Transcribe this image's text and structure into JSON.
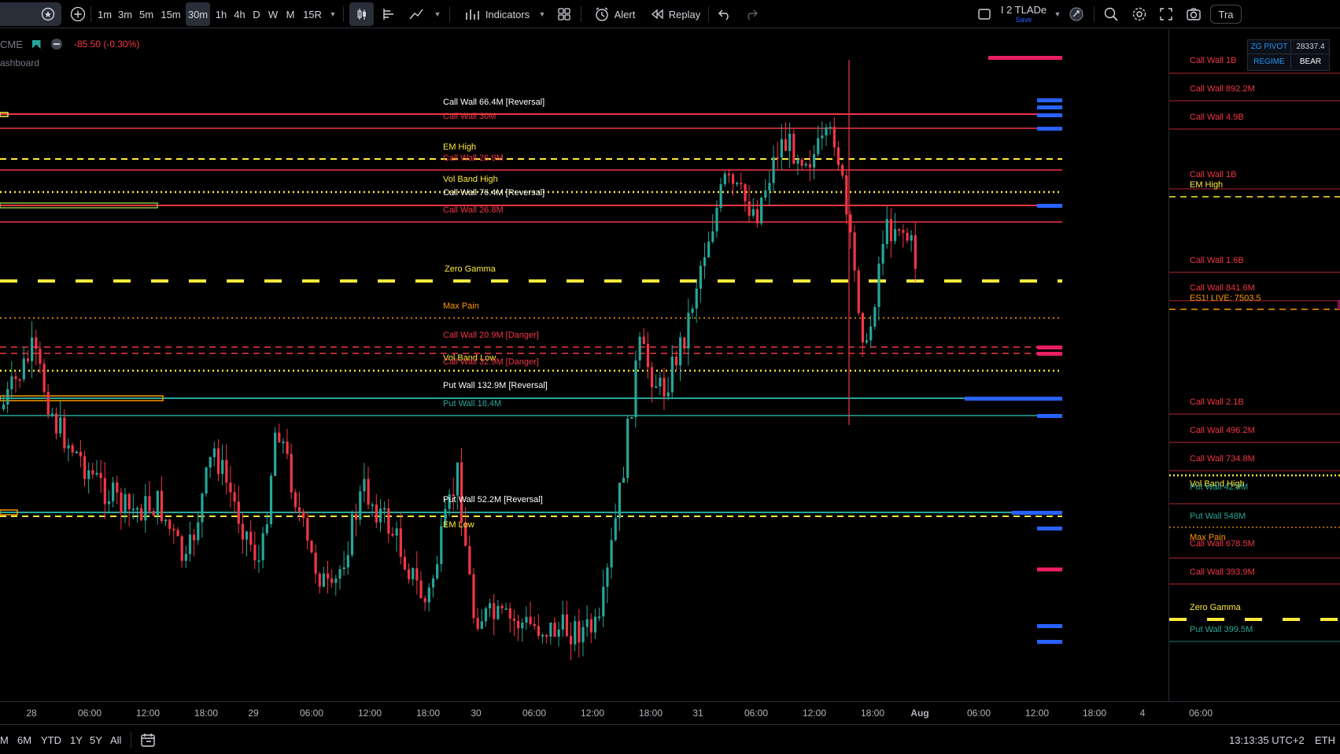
{
  "toolbar": {
    "timeframes": [
      "1m",
      "3m",
      "5m",
      "15m",
      "30m",
      "1h",
      "4h",
      "D",
      "W",
      "M",
      "15R"
    ],
    "active_timeframe": "30m",
    "indicators_label": "Indicators",
    "alert_label": "Alert",
    "replay_label": "Replay",
    "layout_name": "I 2 TLADe",
    "layout_sub": "Save",
    "trade_label": "Tra"
  },
  "legend": {
    "symbol": "CME",
    "change": "-85.50 (-0.30%)",
    "dashboard": "ashboard"
  },
  "zg_widget": {
    "label": "ZG PIVOT",
    "value": "28337.4",
    "regime_label": "REGIME",
    "regime_value": "BEAR"
  },
  "chart_labels": [
    {
      "id": "l1",
      "text": "Call Wall 66.4M [Reversal]",
      "color": "#ffffff"
    },
    {
      "id": "l2",
      "text": "Call Wall 30M",
      "color": "#f23645"
    },
    {
      "id": "l3",
      "text": "EM High",
      "color": "#ffeb3b"
    },
    {
      "id": "l4",
      "text": "Call Wall 26.9M",
      "color": "#f23645"
    },
    {
      "id": "l5",
      "text": "Vol Band High",
      "color": "#ffeb3b"
    },
    {
      "id": "l6",
      "text": "Call Wall 76.4M [Reversal]",
      "color": "#ffffff"
    },
    {
      "id": "l7",
      "text": "Call Wall 26.8M",
      "color": "#f23645"
    },
    {
      "id": "l8",
      "text": "Zero Gamma",
      "color": "#ffeb3b"
    },
    {
      "id": "l9",
      "text": "Max Pain",
      "color": "#ff9800"
    },
    {
      "id": "l10",
      "text": "Call Wall 20.9M [Danger]",
      "color": "#f23645"
    },
    {
      "id": "l11",
      "text": "Vol Band Low",
      "color": "#ffeb3b"
    },
    {
      "id": "l12",
      "text": "Call Wall 32.9M [Danger]",
      "color": "#f23645"
    },
    {
      "id": "l13",
      "text": "Put Wall 132.9M [Reversal]",
      "color": "#ffffff"
    },
    {
      "id": "l14",
      "text": "Put Wall 18.4M",
      "color": "#26a69a"
    },
    {
      "id": "l15",
      "text": "Put Wall 52.2M [Reversal]",
      "color": "#ffffff"
    },
    {
      "id": "l16",
      "text": "EM Low",
      "color": "#ffeb3b"
    }
  ],
  "price_scale_labels": [
    {
      "text": "Call Wall 1B",
      "color": "#f23645"
    },
    {
      "text": "Call Wall 892.2M",
      "color": "#f23645"
    },
    {
      "text": "Call Wall 4.9B",
      "color": "#f23645"
    },
    {
      "text": "Call Wall 1B",
      "color": "#f23645"
    },
    {
      "text": "EM High",
      "color": "#ffeb3b"
    },
    {
      "text": "Call Wall 1.6B",
      "color": "#f23645"
    },
    {
      "text": "Call Wall 841.6M",
      "color": "#f23645"
    },
    {
      "text": "ES1! LIVE: 7503.5",
      "color": "#ff9800"
    },
    {
      "text": "Call Wall 2.1B",
      "color": "#f23645"
    },
    {
      "text": "Call Wall 496.2M",
      "color": "#f23645"
    },
    {
      "text": "Call Wall 734.8M",
      "color": "#f23645"
    },
    {
      "text": "Vol Band High",
      "color": "#ffeb3b"
    },
    {
      "text": "Put Wall 42.9M",
      "color": "#26a69a"
    },
    {
      "text": "Put Wall 548M",
      "color": "#26a69a"
    },
    {
      "text": "Max Pain",
      "color": "#ff9800"
    },
    {
      "text": "Call Wall 678.5M",
      "color": "#f23645"
    },
    {
      "text": "Call Wall 393.9M",
      "color": "#f23645"
    },
    {
      "text": "Zero Gamma",
      "color": "#ffeb3b"
    },
    {
      "text": "Put Wall 399.5M",
      "color": "#26a69a"
    }
  ],
  "time_axis": [
    "28",
    "06:00",
    "12:00",
    "18:00",
    "29",
    "06:00",
    "12:00",
    "18:00",
    "30",
    "06:00",
    "12:00",
    "18:00",
    "31",
    "06:00",
    "12:00",
    "18:00",
    "Aug",
    "06:00",
    "12:00",
    "18:00",
    "4",
    "06:00"
  ],
  "bottom_bar": {
    "ranges": [
      "M",
      "6M",
      "YTD",
      "1Y",
      "5Y",
      "All"
    ],
    "clock": "13:13:35 UTC+2",
    "session": "ETH"
  },
  "colors": {
    "up": "#26a69a",
    "down": "#f23645",
    "call_wall": "#f23645",
    "put_wall": "#26a69a",
    "gamma": "#ffeb3b",
    "max_pain": "#ff9800",
    "marker_blue": "#2962ff",
    "marker_pink": "#e91e63"
  }
}
